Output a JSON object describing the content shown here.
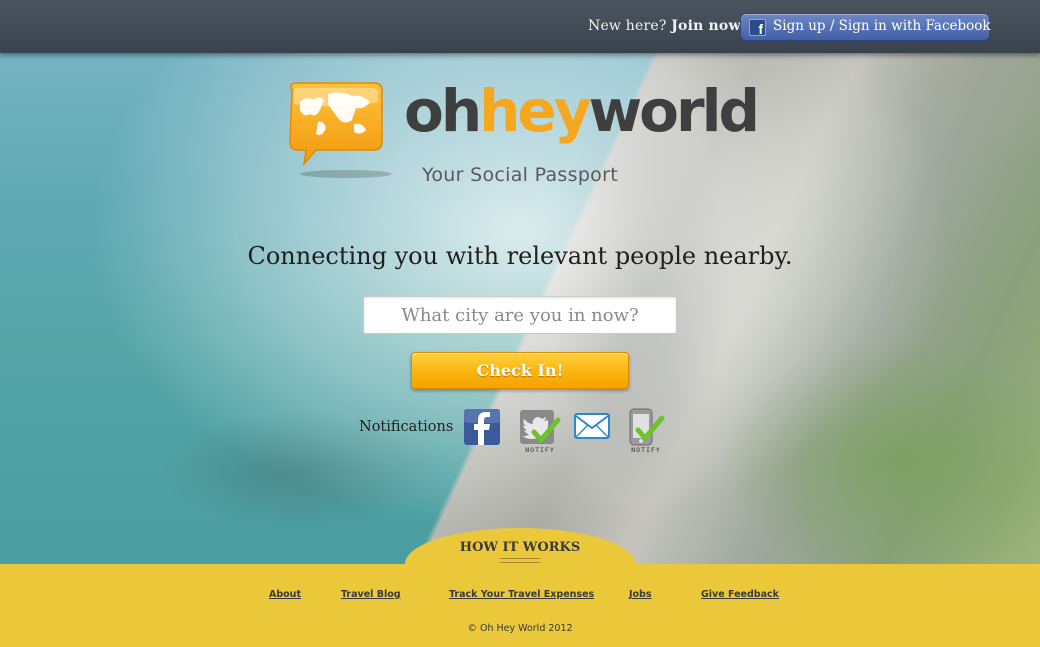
{
  "header": {
    "new_here": "New here?",
    "join_now": "Join now!",
    "facebook_button": "Sign up / Sign in with Facebook"
  },
  "logo": {
    "oh": "oh",
    "hey": "hey",
    "world": "world",
    "tagline": "Your Social Passport"
  },
  "hero": {
    "headline": "Connecting you with relevant people nearby.",
    "city_placeholder": "What city are you in now?",
    "city_value": "",
    "checkin_label": "Check In!"
  },
  "notifications": {
    "label": "Notifications",
    "items": [
      {
        "icon": "facebook-icon",
        "caption": ""
      },
      {
        "icon": "twitter-icon",
        "caption": "NOTIFY"
      },
      {
        "icon": "email-icon",
        "caption": ""
      },
      {
        "icon": "phone-icon",
        "caption": "NOTIFY"
      }
    ]
  },
  "how_it_works": {
    "label": "HOW IT WORKS"
  },
  "footer": {
    "links": [
      "About",
      "Travel Blog",
      "Track Your Travel Expenses",
      "Jobs",
      "Give Feedback"
    ],
    "copyright": "© Oh Hey World 2012"
  },
  "colors": {
    "accent_orange": "#f5a81e",
    "footer_yellow": "#eac83a",
    "facebook_blue": "#4460a6",
    "topbar": "#3f4953"
  }
}
